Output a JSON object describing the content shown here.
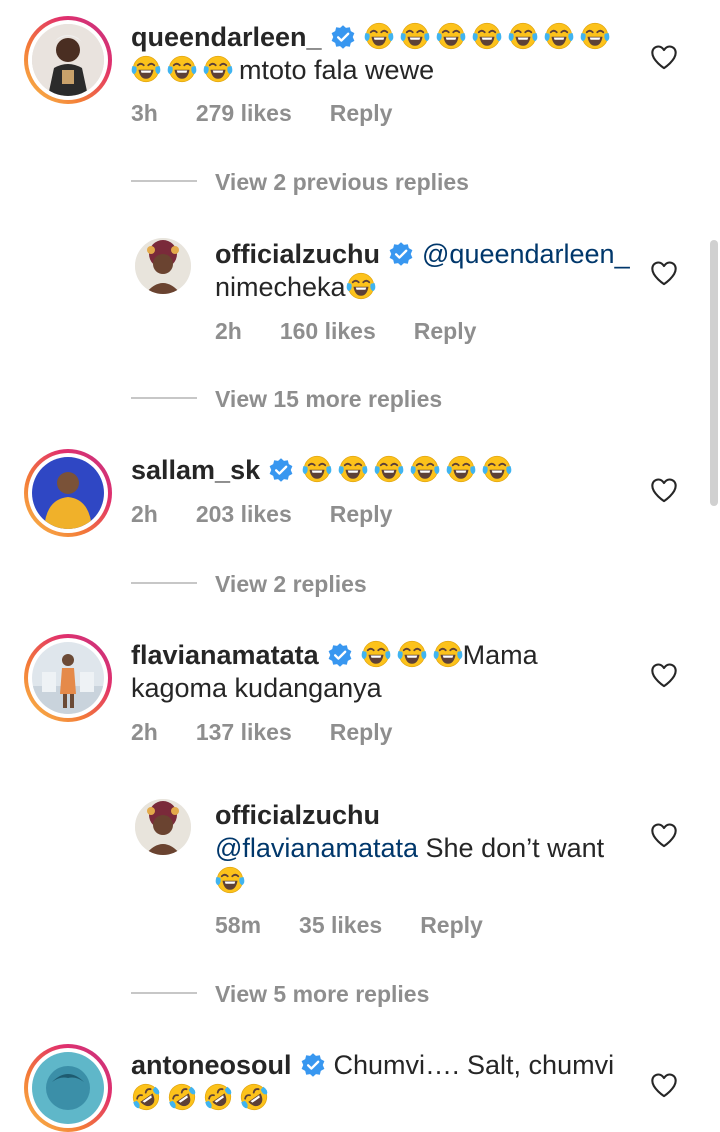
{
  "comments": [
    {
      "username": "queendarleen_",
      "emoji_before": 7,
      "line2_emoji": 3,
      "text": "mtoto fala wewe",
      "time": "3h",
      "likes": "279 likes",
      "reply": "Reply"
    },
    {
      "username": "officialzuchu",
      "mention": "@queendarleen_",
      "text": "nimecheka",
      "time": "2h",
      "likes": "160 likes",
      "reply": "Reply"
    },
    {
      "username": "sallam_sk",
      "time": "2h",
      "likes": "203 likes",
      "reply": "Reply"
    },
    {
      "username": "flavianamatata",
      "text1": "Mama",
      "text2": "kagoma kudanganya",
      "time": "2h",
      "likes": "137 likes",
      "reply": "Reply"
    },
    {
      "username": "officialzuchu",
      "mention": "@flavianamatata",
      "text": "She don’t want",
      "time": "58m",
      "likes": "35 likes",
      "reply": "Reply"
    },
    {
      "username": "antoneosoul",
      "text": "Chumvi…. Salt, chumvi"
    }
  ],
  "view_links": {
    "v1": "View 2 previous replies",
    "v2": "View 15 more replies",
    "v3": "View 2 replies",
    "v4": "View 5 more replies"
  },
  "icons": {
    "verified": "verified-badge-icon",
    "heart": "heart-outline-icon",
    "laugh": "tears-of-joy-emoji",
    "rofl": "rolling-laughing-emoji"
  },
  "colors": {
    "verified_blue": "#3897f0",
    "mention": "#00376b",
    "meta_gray": "#8e8e8e"
  }
}
